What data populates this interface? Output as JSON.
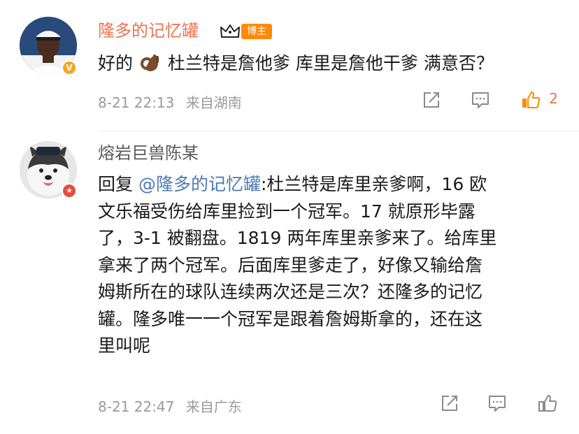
{
  "comments": [
    {
      "author": "隆多的记忆罐",
      "host_badge": "博主",
      "text_before_emoji": "好的",
      "text_after_emoji": "杜兰特是詹他爹 库里是詹他干爹 满意否？",
      "time": "8-21 22:13",
      "location": "来自湖南",
      "like_count": "2",
      "colors": {
        "name": "#eb7350",
        "badge": "#ff8a00",
        "verified": "#f6a623"
      }
    },
    {
      "author": "熔岩巨兽陈某",
      "reply_prefix": "回复",
      "mention": "@隆多的记忆罐",
      "text_lines": [
        ":杜兰特是库里亲爹啊，16 欧",
        "文乐福受伤给库里捡到一个冠军。17 就原形毕露",
        "了，3-1 被翻盘。1819 两年库里亲爹来了。给库里",
        "拿来了两个冠军。后面库里爹走了，好像又输给詹",
        "姆斯所在的球队连续两次还是三次？还隆多的记忆",
        "罐。隆多唯一一个冠军是跟着詹姆斯拿的，还在这",
        "里叫呢"
      ],
      "time": "8-21 22:47",
      "location": "来自广东",
      "colors": {
        "name": "#5a5a5a",
        "mention": "#4d7ab5",
        "verified": "#e84c3d"
      }
    }
  ],
  "icons": {
    "share": "share-icon",
    "comment": "comment-icon",
    "like": "thumbs-up-icon"
  }
}
